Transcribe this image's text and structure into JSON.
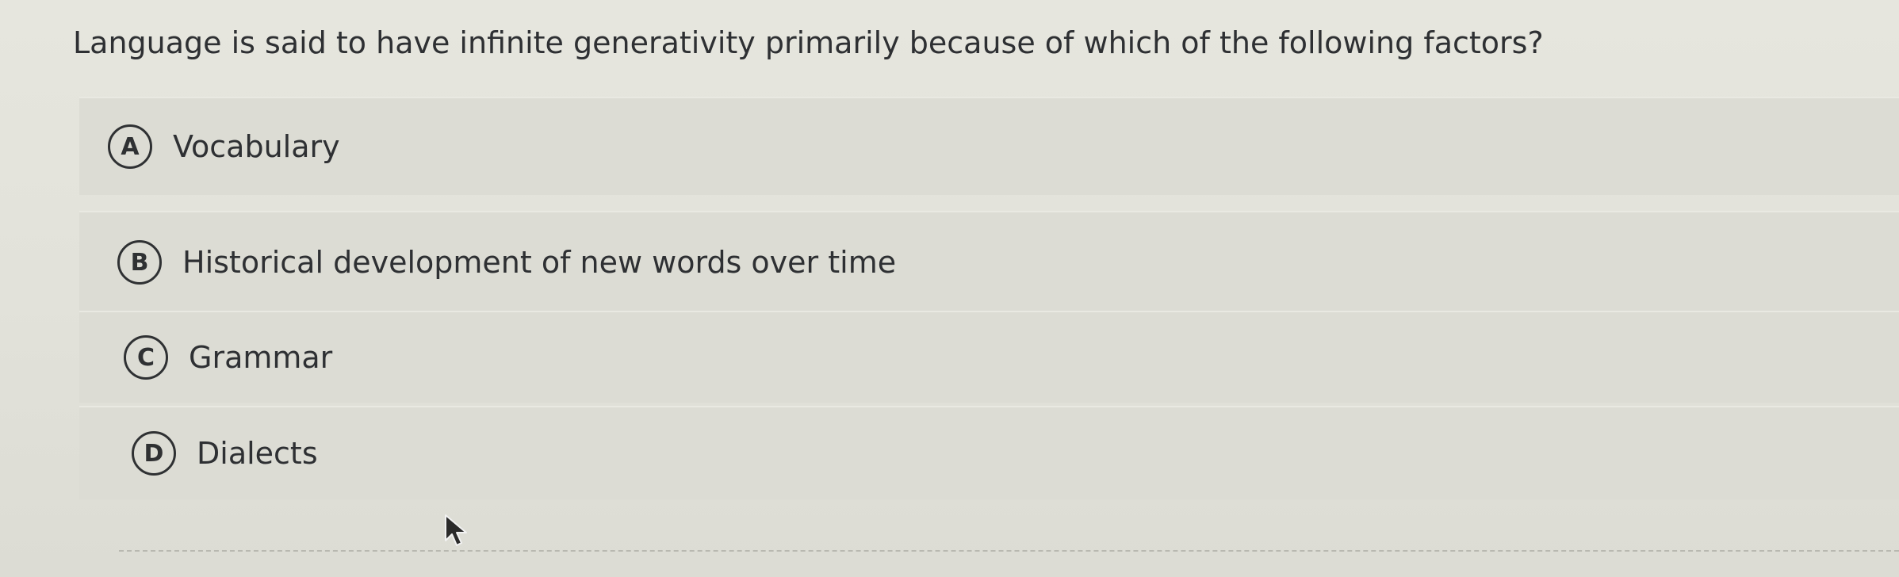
{
  "question": {
    "text": "Language is said to have infinite generativity primarily because of which of the following factors?"
  },
  "options": [
    {
      "letter": "A",
      "text": "Vocabulary"
    },
    {
      "letter": "B",
      "text": "Historical development of new words over time"
    },
    {
      "letter": "C",
      "text": "Grammar"
    },
    {
      "letter": "D",
      "text": "Dialects"
    }
  ],
  "colors": {
    "background": "#e4e4dc",
    "option_background": "#dcdcd4",
    "text": "#2e3033"
  },
  "icons": {
    "cursor": "mouse-pointer-icon"
  }
}
